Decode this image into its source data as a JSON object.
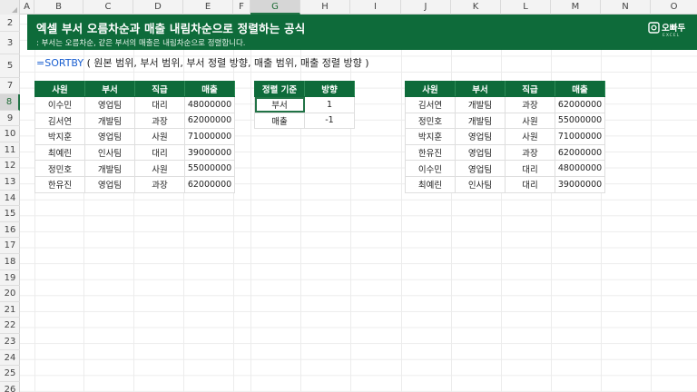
{
  "columns": [
    "A",
    "B",
    "C",
    "D",
    "E",
    "F",
    "G",
    "H",
    "I",
    "J",
    "K",
    "L",
    "M",
    "N",
    "O"
  ],
  "selected_column": "G",
  "rows": [
    "2",
    "3",
    "5",
    "7",
    "8",
    "9",
    "10",
    "11",
    "12",
    "13",
    "14",
    "15",
    "16",
    "17",
    "18",
    "19",
    "20",
    "21",
    "22",
    "23",
    "24",
    "25",
    "26"
  ],
  "selected_row": "8",
  "banner": {
    "title": "엑셀 부서 오름차순과 매출 내림차순으로 정렬하는 공식",
    "subtitle": ": 부서는 오름차순, 같은 부서의 매출은 내림차순으로 정렬합니다.",
    "logo_name": "오빠두",
    "logo_small": "EXCEL"
  },
  "formula": {
    "fn": "=SORTBY",
    "args": " ( 원본 범위, 부서 범위, 부서 정렬 방향, 매출 범위, 매출 정렬 방향 )"
  },
  "source_table": {
    "headers": [
      "사원",
      "부서",
      "직급",
      "매출"
    ],
    "rows": [
      [
        "이수민",
        "영업팀",
        "대리",
        "48000000"
      ],
      [
        "김서연",
        "개발팀",
        "과장",
        "62000000"
      ],
      [
        "박지훈",
        "영업팀",
        "사원",
        "71000000"
      ],
      [
        "최예린",
        "인사팀",
        "대리",
        "39000000"
      ],
      [
        "정민호",
        "개발팀",
        "사원",
        "55000000"
      ],
      [
        "한유진",
        "영업팀",
        "과장",
        "62000000"
      ]
    ]
  },
  "criteria_table": {
    "headers": [
      "정렬 기준",
      "방향"
    ],
    "rows": [
      [
        "부서",
        "1"
      ],
      [
        "매출",
        "-1"
      ]
    ]
  },
  "result_table": {
    "headers": [
      "사원",
      "부서",
      "직급",
      "매출"
    ],
    "rows": [
      [
        "김서연",
        "개발팀",
        "과장",
        "62000000"
      ],
      [
        "정민호",
        "개발팀",
        "사원",
        "55000000"
      ],
      [
        "박지훈",
        "영업팀",
        "사원",
        "71000000"
      ],
      [
        "한유진",
        "영업팀",
        "과장",
        "62000000"
      ],
      [
        "이수민",
        "영업팀",
        "대리",
        "48000000"
      ],
      [
        "최예린",
        "인사팀",
        "대리",
        "39000000"
      ]
    ]
  },
  "colors": {
    "accent": "#0e6b3a",
    "selection": "#217346",
    "function": "#1a5fd0"
  }
}
